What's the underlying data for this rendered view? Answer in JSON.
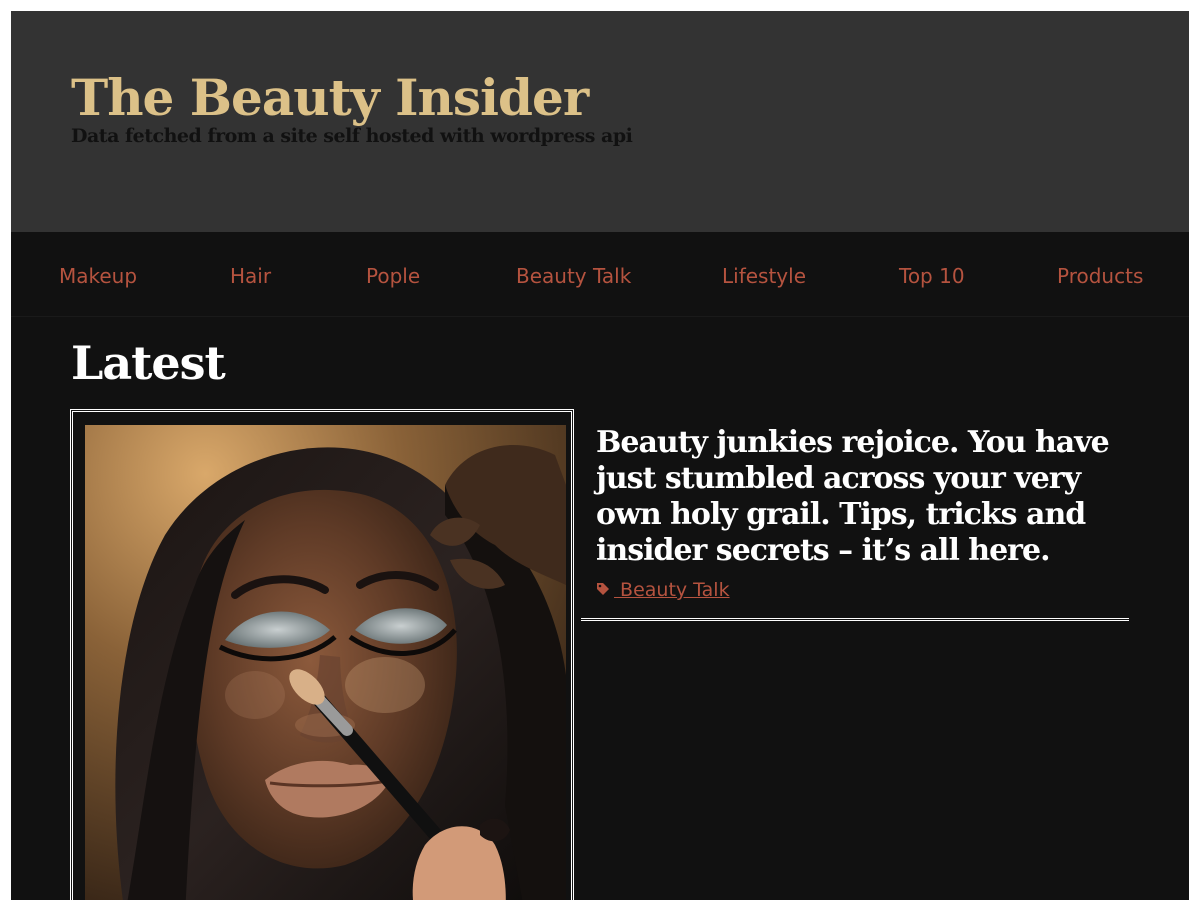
{
  "site": {
    "title": "The Beauty Insider",
    "tagline": "Data fetched from a site self hosted with wordpress api"
  },
  "colors": {
    "title_gold": "#dcc188",
    "nav_link": "#b5533f",
    "header_bg": "#333333",
    "page_bg": "#111111"
  },
  "nav": {
    "items": [
      {
        "label": "Makeup"
      },
      {
        "label": "Hair"
      },
      {
        "label": "Pople"
      },
      {
        "label": "Beauty Talk"
      },
      {
        "label": "Lifestyle"
      },
      {
        "label": "Top 10"
      },
      {
        "label": "Products"
      }
    ]
  },
  "main": {
    "section_title": "Latest",
    "post": {
      "headline": "Beauty junkies rejoice. You have just stumbled across your very own holy grail. Tips, tricks and insider secrets – it’s all here.",
      "category": " Beauty Talk",
      "category_icon": "tag-icon",
      "image_icon": "makeup-photo"
    }
  }
}
